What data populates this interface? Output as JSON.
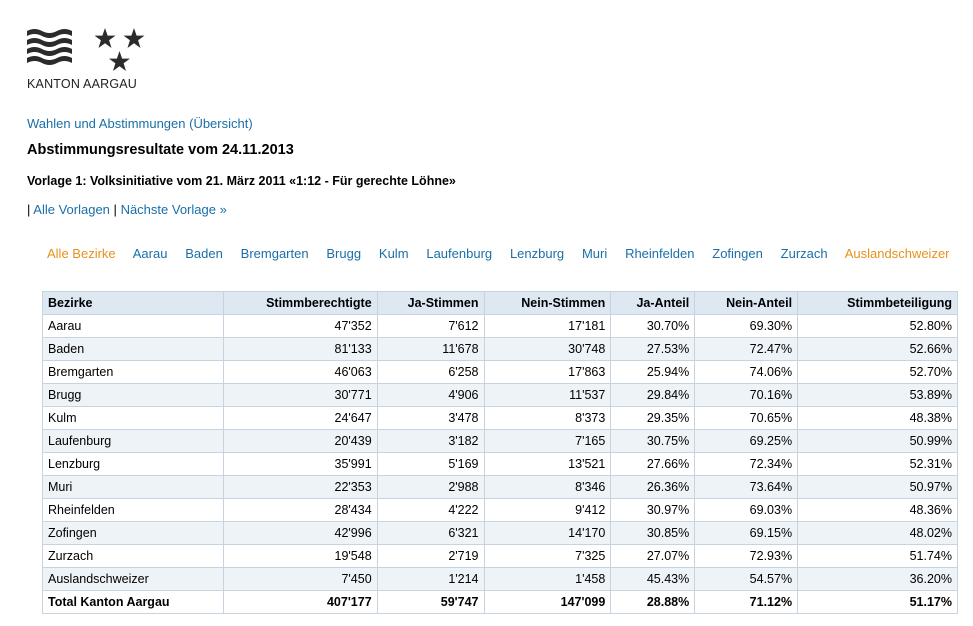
{
  "logo": {
    "text": "KANTON AARGAU"
  },
  "nav": {
    "overview_link": "Wahlen und Abstimmungen (Übersicht)",
    "pipe1": "|",
    "all_label": "Alle Vorlagen",
    "pipe2": "|",
    "next_label": "Nächste Vorlage »"
  },
  "page": {
    "title": "Abstimmungsresultate vom 24.11.2013",
    "subtitle": "Vorlage 1: Volksinitiative vom 21. März 2011 «1:12 - Für gerechte Löhne»"
  },
  "colors": {
    "link": "#1a6fa8",
    "active": "#e8901c",
    "header_bg": "#dde8f2",
    "alt_row": "#eef3f8"
  },
  "tabs": [
    "Alle Bezirke",
    "Aarau",
    "Baden",
    "Bremgarten",
    "Brugg",
    "Kulm",
    "Laufenburg",
    "Lenzburg",
    "Muri",
    "Rheinfelden",
    "Zofingen",
    "Zurzach",
    "Auslandschweizer"
  ],
  "table": {
    "headers": [
      "Bezirke",
      "Stimmberechtigte",
      "Ja-Stimmen",
      "Nein-Stimmen",
      "Ja-Anteil",
      "Nein-Anteil",
      "Stimmbeteiligung"
    ],
    "rows": [
      [
        "Aarau",
        "47'352",
        "7'612",
        "17'181",
        "30.70%",
        "69.30%",
        "52.80%"
      ],
      [
        "Baden",
        "81'133",
        "11'678",
        "30'748",
        "27.53%",
        "72.47%",
        "52.66%"
      ],
      [
        "Bremgarten",
        "46'063",
        "6'258",
        "17'863",
        "25.94%",
        "74.06%",
        "52.70%"
      ],
      [
        "Brugg",
        "30'771",
        "4'906",
        "11'537",
        "29.84%",
        "70.16%",
        "53.89%"
      ],
      [
        "Kulm",
        "24'647",
        "3'478",
        "8'373",
        "29.35%",
        "70.65%",
        "48.38%"
      ],
      [
        "Laufenburg",
        "20'439",
        "3'182",
        "7'165",
        "30.75%",
        "69.25%",
        "50.99%"
      ],
      [
        "Lenzburg",
        "35'991",
        "5'169",
        "13'521",
        "27.66%",
        "72.34%",
        "52.31%"
      ],
      [
        "Muri",
        "22'353",
        "2'988",
        "8'346",
        "26.36%",
        "73.64%",
        "50.97%"
      ],
      [
        "Rheinfelden",
        "28'434",
        "4'222",
        "9'412",
        "30.97%",
        "69.03%",
        "48.36%"
      ],
      [
        "Zofingen",
        "42'996",
        "6'321",
        "14'170",
        "30.85%",
        "69.15%",
        "48.02%"
      ],
      [
        "Zurzach",
        "19'548",
        "2'719",
        "7'325",
        "27.07%",
        "72.93%",
        "51.74%"
      ],
      [
        "Auslandschweizer",
        "7'450",
        "1'214",
        "1'458",
        "45.43%",
        "54.57%",
        "36.20%"
      ]
    ],
    "total": [
      "Total Kanton Aargau",
      "407'177",
      "59'747",
      "147'099",
      "28.88%",
      "71.12%",
      "51.17%"
    ]
  }
}
